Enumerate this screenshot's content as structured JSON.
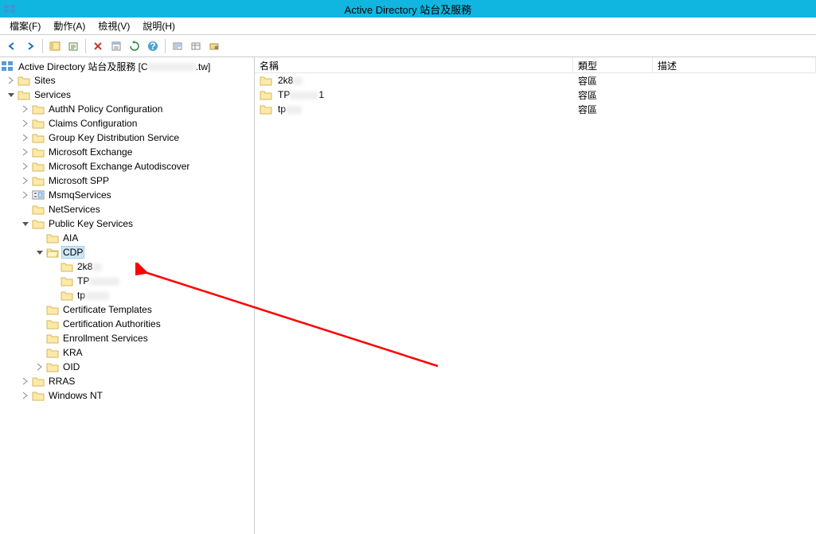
{
  "window": {
    "title": "Active Directory 站台及服務"
  },
  "menubar": {
    "file": "檔案(F)",
    "action": "動作(A)",
    "view": "檢視(V)",
    "help": "說明(H)"
  },
  "tree": {
    "root": "Active Directory 站台及服務 [C",
    "root_suffix": ".tw]",
    "sites": "Sites",
    "services": "Services",
    "authn": "AuthN Policy Configuration",
    "claims": "Claims Configuration",
    "gkds": "Group Key Distribution Service",
    "msex": "Microsoft Exchange",
    "msexauto": "Microsoft Exchange Autodiscover",
    "msspp": "Microsoft SPP",
    "msmq": "MsmqServices",
    "netsvc": "NetServices",
    "pks": "Public Key Services",
    "aia": "AIA",
    "cdp": "CDP",
    "cdp1": "2k8",
    "cdp2": "TP",
    "cdp3": "tp",
    "certtpl": "Certificate Templates",
    "certauth": "Certification Authorities",
    "enroll": "Enrollment Services",
    "kra": "KRA",
    "oid": "OID",
    "rras": "RRAS",
    "winnt": "Windows NT"
  },
  "list": {
    "columns": {
      "name": "名稱",
      "type": "類型",
      "desc": "描述"
    },
    "rows": [
      {
        "name": "2k8",
        "blurw": 12,
        "type": "容區"
      },
      {
        "name": "TP",
        "suffix": "1",
        "blurw": 36,
        "type": "容區"
      },
      {
        "name": "tp",
        "blurw": 20,
        "type": "容區"
      }
    ]
  }
}
